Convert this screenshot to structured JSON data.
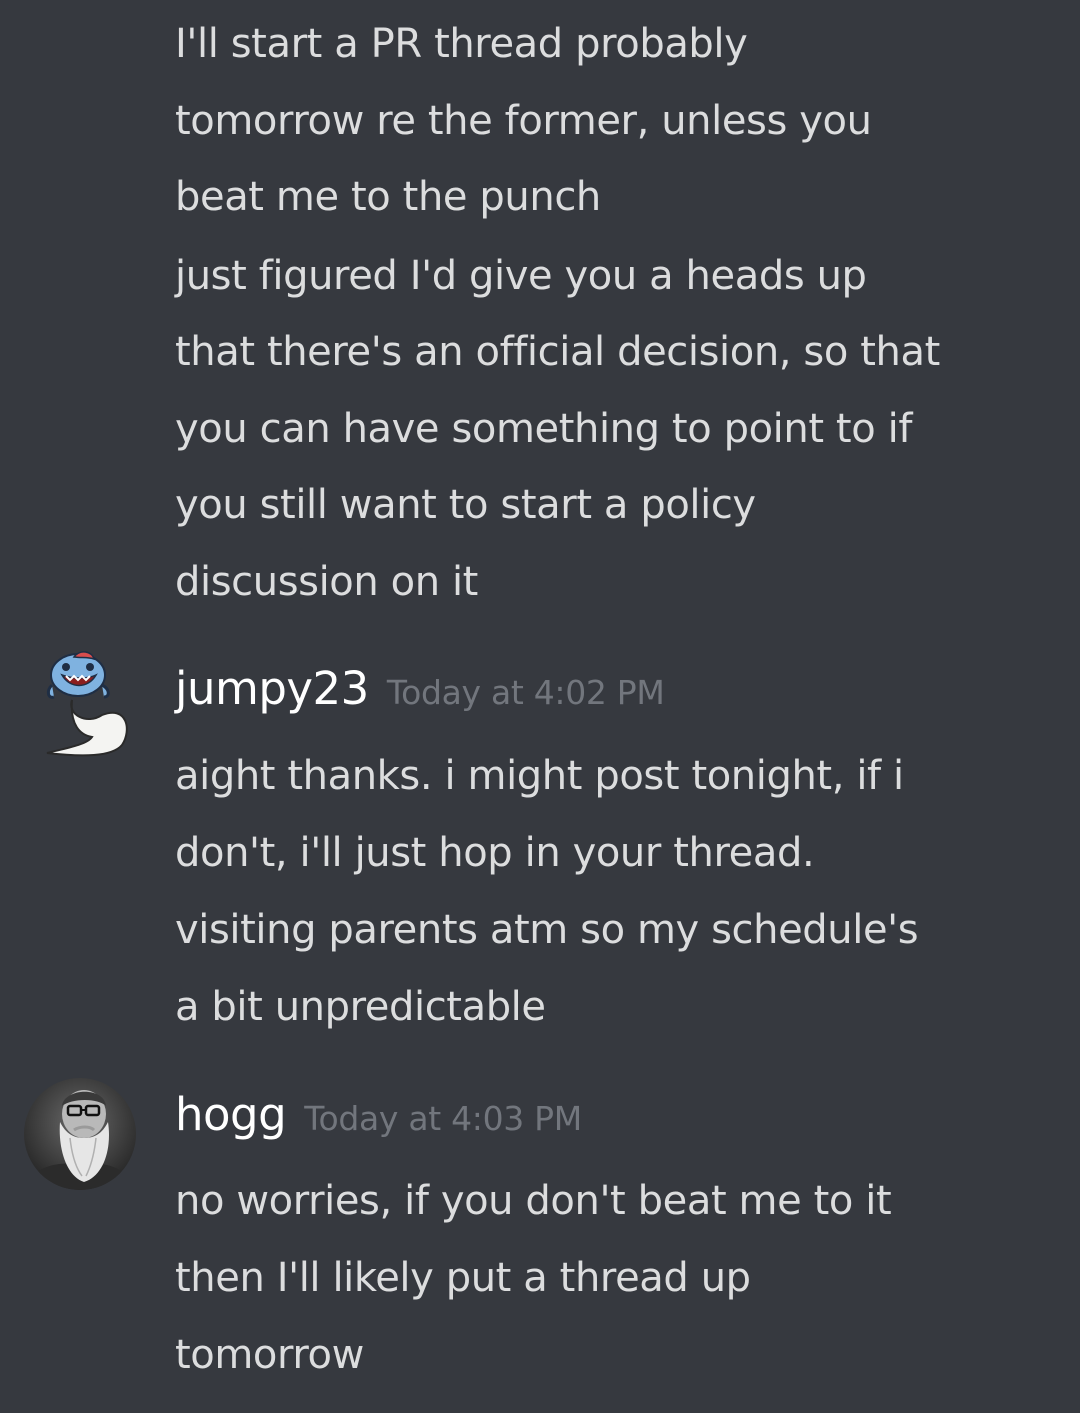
{
  "messages": {
    "continued": {
      "lines": [
        "I'll start a PR thread probably",
        "tomorrow re the former, unless you",
        "beat me to the punch",
        "just figured I'd give you a heads up",
        "that there's an official decision, so that",
        "you can have something to point to if",
        "you still want to start a policy",
        "discussion on it"
      ]
    },
    "jumpy23": {
      "username": "jumpy23",
      "timestamp": "Today at 4:02 PM",
      "avatar_icon": "pokemon-sprite-avatar",
      "lines": [
        "aight thanks. i might post tonight, if i",
        "don't, i'll just hop in your thread.",
        "visiting parents atm so my schedule's",
        "a bit unpredictable"
      ]
    },
    "hogg": {
      "username": "hogg",
      "timestamp": "Today at 4:03 PM",
      "avatar_icon": "bearded-man-photo-avatar",
      "lines": [
        "no worries, if you don't beat me to it",
        "then I'll likely put a thread up",
        "tomorrow"
      ]
    }
  },
  "colors": {
    "background": "#36393f",
    "text": "#dcddde",
    "username": "#ffffff",
    "timestamp": "#72767d"
  }
}
